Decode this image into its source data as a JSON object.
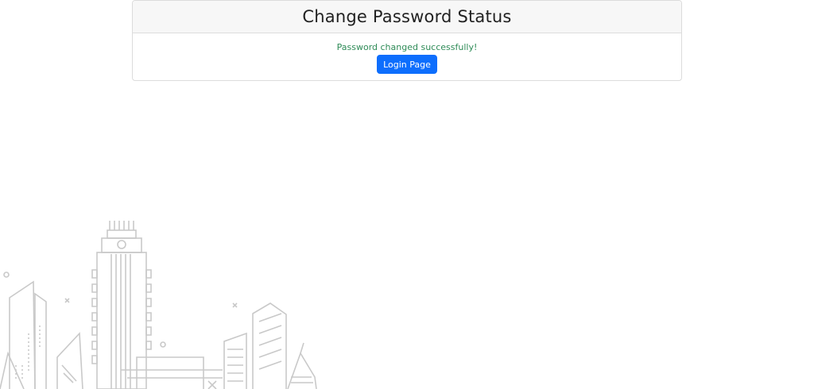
{
  "card": {
    "title": "Change Password Status",
    "status_message": "Password changed successfully!",
    "status_color": "#2e8b57",
    "login_button_label": "Login Page",
    "button_color": "#0d6efd"
  },
  "decoration": {
    "illustration": "city-skyline-line-art"
  }
}
